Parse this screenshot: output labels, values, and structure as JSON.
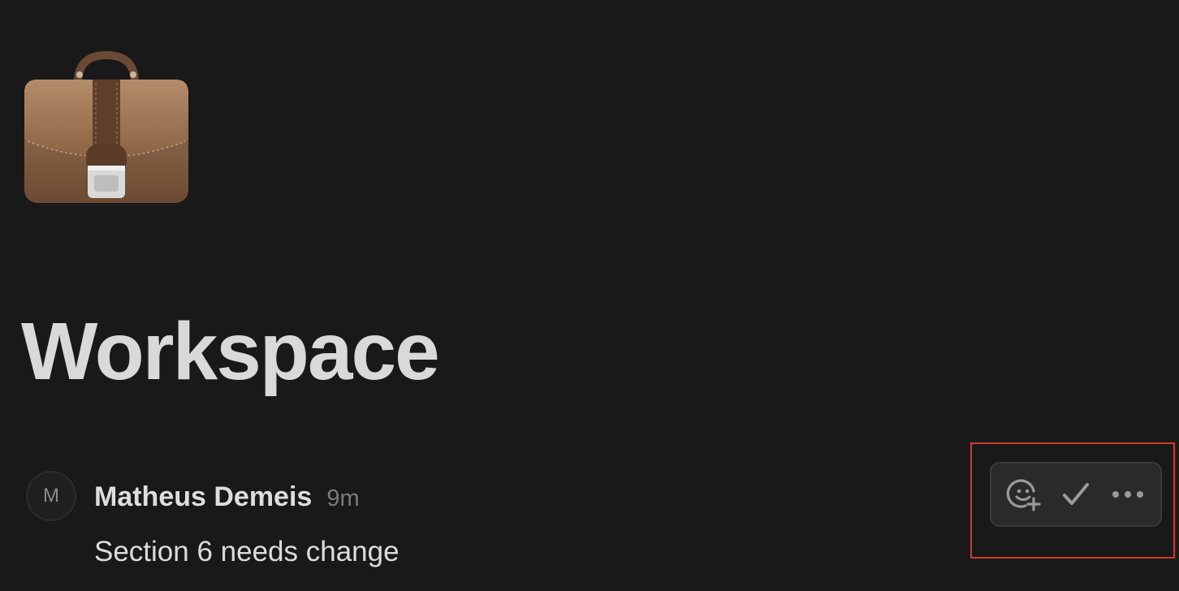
{
  "page": {
    "icon": "briefcase-icon",
    "title": "Workspace"
  },
  "comment": {
    "avatar_initial": "M",
    "author": "Matheus Demeis",
    "time": "9m",
    "body": "Section 6 needs change"
  },
  "actions": [
    {
      "icon": "add-reaction-icon"
    },
    {
      "icon": "checkmark-icon"
    },
    {
      "icon": "more-icon"
    }
  ],
  "colors": {
    "background": "#191919",
    "highlight": "#d33a2c",
    "toolbar": "#2a2a2a"
  }
}
